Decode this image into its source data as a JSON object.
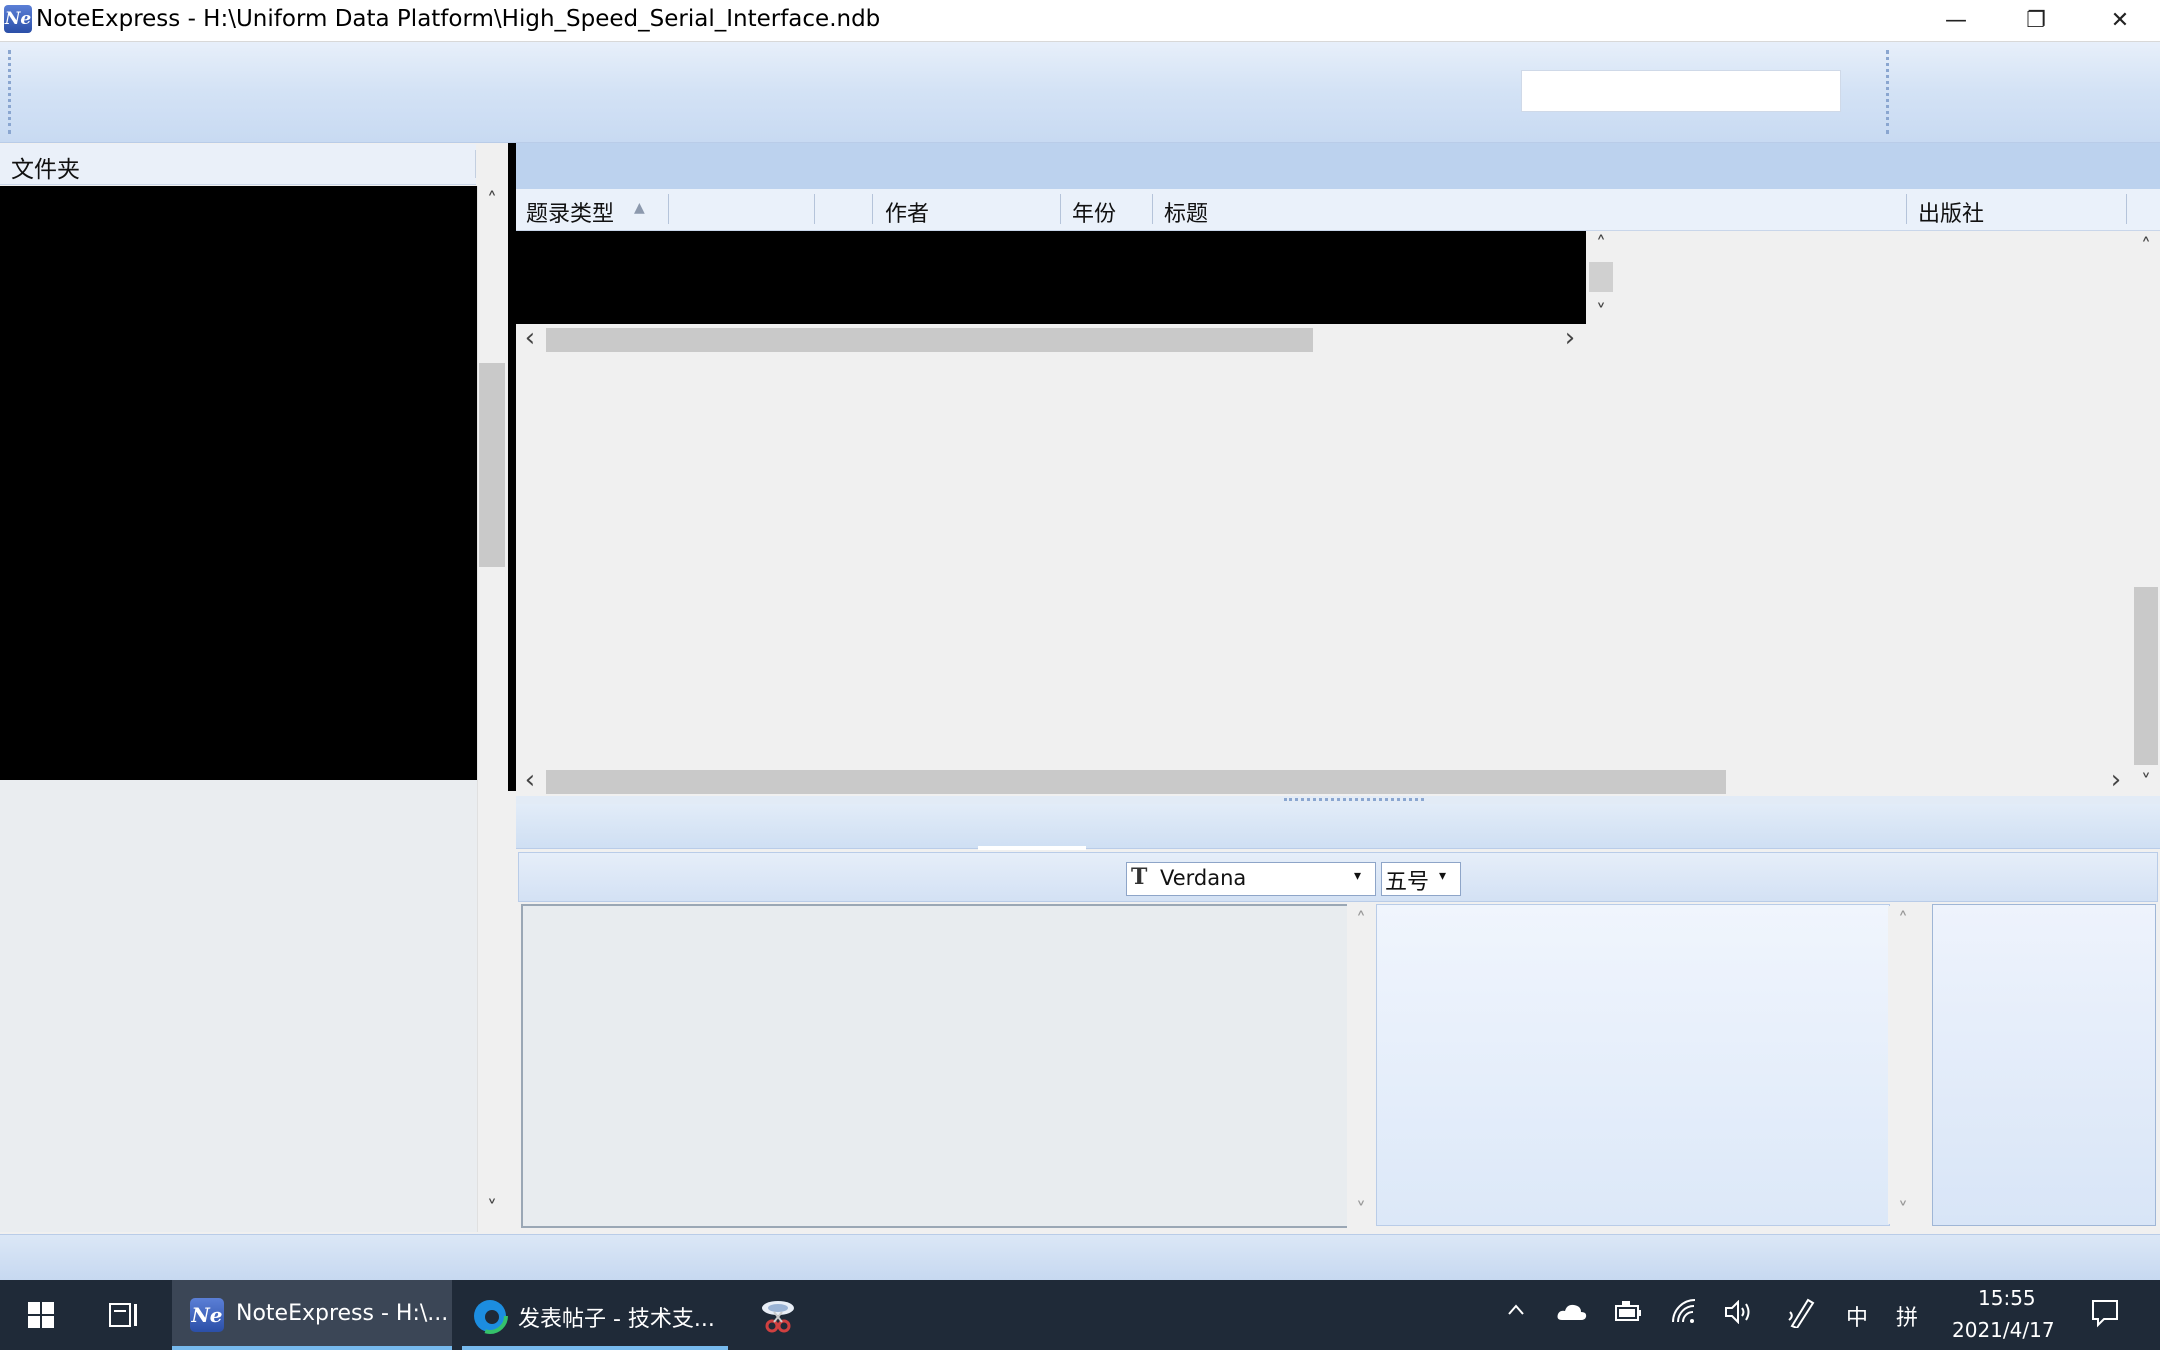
{
  "window": {
    "title": "NoteExpress - H:\\Uniform Data Platform\\High_Speed_Serial_Interface.ndb",
    "app_icon_text": "Ne",
    "controls": {
      "minimize": "—",
      "restore": "❐",
      "close": "✕"
    }
  },
  "toolbar": {
    "search_placeholder": ""
  },
  "folders": {
    "header": "文件夹"
  },
  "list": {
    "columns": [
      {
        "label": "题录类型"
      },
      {
        "label": ""
      },
      {
        "label": ""
      },
      {
        "label": "作者"
      },
      {
        "label": "年份"
      },
      {
        "label": "标题"
      },
      {
        "label": "出版社"
      }
    ],
    "sort_indicator": "▲"
  },
  "editor": {
    "font_icon": "T",
    "font": "Verdana",
    "size": "五号",
    "dropdown_arrow": "▾"
  },
  "scroll": {
    "up": "˄",
    "down": "˅",
    "left": "‹",
    "right": "›"
  },
  "taskbar": {
    "start_icon": "windows-logo",
    "apps": [
      {
        "icon": "Ne",
        "label": "NoteExpress - H:\\..."
      },
      {
        "label": "发表帖子 - 技术支..."
      }
    ],
    "tray": {
      "ime_lang": "中",
      "ime_mode": "拼",
      "time": "15:55",
      "date": "2021/4/17"
    }
  }
}
